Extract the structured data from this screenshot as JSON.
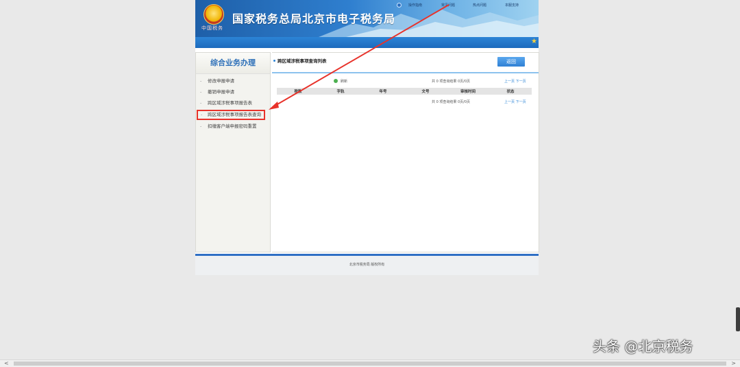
{
  "header": {
    "site_title": "国家税务总局北京市电子税务局",
    "emblem_text": "中国税务",
    "links": [
      "操作指南",
      "常见问题",
      "热点问题",
      "本服支持"
    ]
  },
  "sidebar": {
    "title": "综合业务办理",
    "items": [
      {
        "label": "修改申报申请"
      },
      {
        "label": "撤销申报申请"
      },
      {
        "label": "跨区域涉税事项报告表"
      },
      {
        "label": "跨区域涉税事项报告表查询"
      },
      {
        "label": "扣缴客户端申报密码重置"
      }
    ],
    "dash": "-"
  },
  "main": {
    "panel_title": "跨区域涉税事项查询列表",
    "return_label": "返回",
    "refresh_label": "刷新",
    "result_count": "共 0 项查询结果 0页/0页",
    "prev_page": "上一页",
    "next_page": "下一页",
    "columns": [
      "税款",
      "字轨",
      "年号",
      "文号",
      "审核时间",
      "状态"
    ]
  },
  "footer": {
    "copyright": "北京市税务局 版权所有"
  },
  "watermark": "头条 @北京税务",
  "scroll": {
    "left": "<",
    "right": ">"
  },
  "icons": {
    "gear": "gear-icon",
    "star": "★",
    "refresh": "refresh-icon"
  },
  "colors": {
    "accent": "#2c84d6",
    "highlight": "#e8322a"
  }
}
